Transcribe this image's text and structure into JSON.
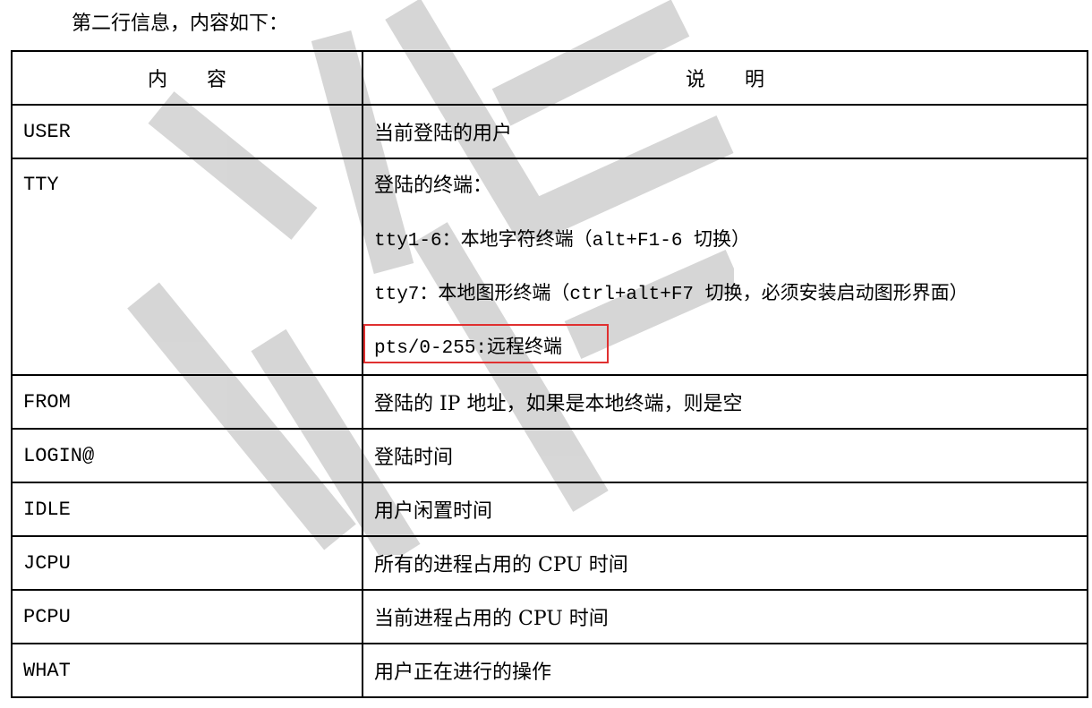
{
  "intro": "第二行信息，内容如下：",
  "header": {
    "col1": "内　　容",
    "col2": "说　　明"
  },
  "tty": {
    "name": "TTY",
    "lines": [
      "登陆的终端：",
      "tty1-6：本地字符终端（alt+F1-6 切换）",
      "tty7：本地图形终端（ctrl+alt+F7 切换，必须安装启动图形界面）",
      "pts/0-255:远程终端"
    ],
    "highlight_color": "#e03030"
  },
  "rows": [
    {
      "name": "USER",
      "desc": "当前登陆的用户"
    },
    {
      "name": "FROM",
      "desc": "登陆的 IP 地址，如果是本地终端，则是空"
    },
    {
      "name": "LOGIN@",
      "desc": "登陆时间"
    },
    {
      "name": "IDLE",
      "desc": "用户闲置时间"
    },
    {
      "name": "JCPU",
      "desc": "所有的进程占用的 CPU 时间"
    },
    {
      "name": "PCPU",
      "desc": "当前进程占用的 CPU 时间"
    },
    {
      "name": "WHAT",
      "desc": "用户正在进行的操作"
    }
  ],
  "watermark_color": "#c8c8c8"
}
